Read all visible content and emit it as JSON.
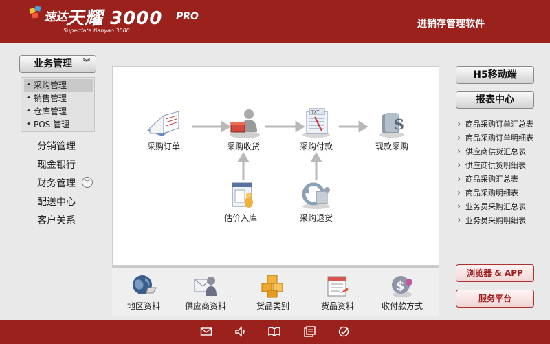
{
  "header": {
    "brand_prefix": "速达",
    "brand_name": "天耀 3000",
    "brand_edition": "PRO",
    "brand_subtitle": "Superdata tianyao 3000",
    "app_title": "进销存管理软件"
  },
  "sidebar": {
    "module_label": "业务管理",
    "submenu": [
      {
        "label": "采购管理",
        "active": true
      },
      {
        "label": "销售管理"
      },
      {
        "label": "仓库管理"
      },
      {
        "label": "POS 管理"
      }
    ],
    "nav": [
      "分销管理",
      "现金银行",
      "财务管理",
      "配送中心",
      "客户关系"
    ]
  },
  "workflow": {
    "purchase_order": "采购订单",
    "purchase_receipt": "采购收货",
    "purchase_payment": "采购付款",
    "cash_purchase": "现款采购",
    "estimated_stock_in": "估价入库",
    "purchase_return": "采购退货"
  },
  "toolbar": {
    "region": "地区资料",
    "supplier": "供应商资料",
    "goods_category": "货品类别",
    "goods": "货品资料",
    "payment_method": "收付款方式"
  },
  "right": {
    "h5_label": "H5移动端",
    "report_center_label": "报表中心",
    "reports": [
      "商品采购订单汇总表",
      "商品采购订单明细表",
      "供应商供货汇总表",
      "供应商供货明细表",
      "商品采购汇总表",
      "商品采购明细表",
      "业务员采购汇总表",
      "业务员采购明细表"
    ],
    "browser_app_label": "浏览器 & APP",
    "service_label": "服务平台"
  },
  "colors": {
    "header_bg": "#9b211d",
    "accent": "#a01b1b"
  }
}
